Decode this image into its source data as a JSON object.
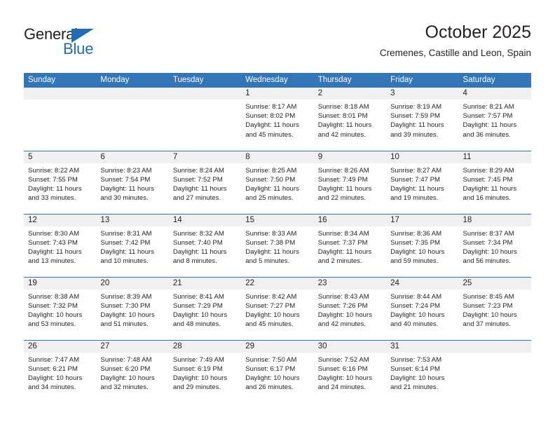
{
  "brand": {
    "name_top": "General",
    "name_bottom": "Blue",
    "accent_color": "#1f6db5",
    "triangle_icon": "brand-triangle-icon"
  },
  "header": {
    "title": "October 2025",
    "subtitle": "Cremenes, Castille and Leon, Spain"
  },
  "theme": {
    "header_row_bg": "#3276b8",
    "header_row_text": "#ffffff",
    "daynum_band_bg": "#f0f0f0",
    "row_divider": "#3276b8",
    "text": "#231f20",
    "cell_bg": "#ffffff"
  },
  "weekdays": [
    "Sunday",
    "Monday",
    "Tuesday",
    "Wednesday",
    "Thursday",
    "Friday",
    "Saturday"
  ],
  "labels": {
    "sunrise_prefix": "Sunrise:",
    "sunset_prefix": "Sunset:",
    "daylight_prefix": "Daylight:"
  },
  "weeks": [
    [
      {
        "day": "",
        "empty": true,
        "sunrise": "",
        "sunset": "",
        "daylight": ""
      },
      {
        "day": "",
        "empty": true,
        "sunrise": "",
        "sunset": "",
        "daylight": ""
      },
      {
        "day": "",
        "empty": true,
        "sunrise": "",
        "sunset": "",
        "daylight": ""
      },
      {
        "day": "1",
        "empty": false,
        "sunrise": "Sunrise: 8:17 AM",
        "sunset": "Sunset: 8:02 PM",
        "daylight": "Daylight: 11 hours and 45 minutes."
      },
      {
        "day": "2",
        "empty": false,
        "sunrise": "Sunrise: 8:18 AM",
        "sunset": "Sunset: 8:01 PM",
        "daylight": "Daylight: 11 hours and 42 minutes."
      },
      {
        "day": "3",
        "empty": false,
        "sunrise": "Sunrise: 8:19 AM",
        "sunset": "Sunset: 7:59 PM",
        "daylight": "Daylight: 11 hours and 39 minutes."
      },
      {
        "day": "4",
        "empty": false,
        "sunrise": "Sunrise: 8:21 AM",
        "sunset": "Sunset: 7:57 PM",
        "daylight": "Daylight: 11 hours and 36 minutes."
      }
    ],
    [
      {
        "day": "5",
        "empty": false,
        "sunrise": "Sunrise: 8:22 AM",
        "sunset": "Sunset: 7:55 PM",
        "daylight": "Daylight: 11 hours and 33 minutes."
      },
      {
        "day": "6",
        "empty": false,
        "sunrise": "Sunrise: 8:23 AM",
        "sunset": "Sunset: 7:54 PM",
        "daylight": "Daylight: 11 hours and 30 minutes."
      },
      {
        "day": "7",
        "empty": false,
        "sunrise": "Sunrise: 8:24 AM",
        "sunset": "Sunset: 7:52 PM",
        "daylight": "Daylight: 11 hours and 27 minutes."
      },
      {
        "day": "8",
        "empty": false,
        "sunrise": "Sunrise: 8:25 AM",
        "sunset": "Sunset: 7:50 PM",
        "daylight": "Daylight: 11 hours and 25 minutes."
      },
      {
        "day": "9",
        "empty": false,
        "sunrise": "Sunrise: 8:26 AM",
        "sunset": "Sunset: 7:49 PM",
        "daylight": "Daylight: 11 hours and 22 minutes."
      },
      {
        "day": "10",
        "empty": false,
        "sunrise": "Sunrise: 8:27 AM",
        "sunset": "Sunset: 7:47 PM",
        "daylight": "Daylight: 11 hours and 19 minutes."
      },
      {
        "day": "11",
        "empty": false,
        "sunrise": "Sunrise: 8:29 AM",
        "sunset": "Sunset: 7:45 PM",
        "daylight": "Daylight: 11 hours and 16 minutes."
      }
    ],
    [
      {
        "day": "12",
        "empty": false,
        "sunrise": "Sunrise: 8:30 AM",
        "sunset": "Sunset: 7:43 PM",
        "daylight": "Daylight: 11 hours and 13 minutes."
      },
      {
        "day": "13",
        "empty": false,
        "sunrise": "Sunrise: 8:31 AM",
        "sunset": "Sunset: 7:42 PM",
        "daylight": "Daylight: 11 hours and 10 minutes."
      },
      {
        "day": "14",
        "empty": false,
        "sunrise": "Sunrise: 8:32 AM",
        "sunset": "Sunset: 7:40 PM",
        "daylight": "Daylight: 11 hours and 8 minutes."
      },
      {
        "day": "15",
        "empty": false,
        "sunrise": "Sunrise: 8:33 AM",
        "sunset": "Sunset: 7:38 PM",
        "daylight": "Daylight: 11 hours and 5 minutes."
      },
      {
        "day": "16",
        "empty": false,
        "sunrise": "Sunrise: 8:34 AM",
        "sunset": "Sunset: 7:37 PM",
        "daylight": "Daylight: 11 hours and 2 minutes."
      },
      {
        "day": "17",
        "empty": false,
        "sunrise": "Sunrise: 8:36 AM",
        "sunset": "Sunset: 7:35 PM",
        "daylight": "Daylight: 10 hours and 59 minutes."
      },
      {
        "day": "18",
        "empty": false,
        "sunrise": "Sunrise: 8:37 AM",
        "sunset": "Sunset: 7:34 PM",
        "daylight": "Daylight: 10 hours and 56 minutes."
      }
    ],
    [
      {
        "day": "19",
        "empty": false,
        "sunrise": "Sunrise: 8:38 AM",
        "sunset": "Sunset: 7:32 PM",
        "daylight": "Daylight: 10 hours and 53 minutes."
      },
      {
        "day": "20",
        "empty": false,
        "sunrise": "Sunrise: 8:39 AM",
        "sunset": "Sunset: 7:30 PM",
        "daylight": "Daylight: 10 hours and 51 minutes."
      },
      {
        "day": "21",
        "empty": false,
        "sunrise": "Sunrise: 8:41 AM",
        "sunset": "Sunset: 7:29 PM",
        "daylight": "Daylight: 10 hours and 48 minutes."
      },
      {
        "day": "22",
        "empty": false,
        "sunrise": "Sunrise: 8:42 AM",
        "sunset": "Sunset: 7:27 PM",
        "daylight": "Daylight: 10 hours and 45 minutes."
      },
      {
        "day": "23",
        "empty": false,
        "sunrise": "Sunrise: 8:43 AM",
        "sunset": "Sunset: 7:26 PM",
        "daylight": "Daylight: 10 hours and 42 minutes."
      },
      {
        "day": "24",
        "empty": false,
        "sunrise": "Sunrise: 8:44 AM",
        "sunset": "Sunset: 7:24 PM",
        "daylight": "Daylight: 10 hours and 40 minutes."
      },
      {
        "day": "25",
        "empty": false,
        "sunrise": "Sunrise: 8:45 AM",
        "sunset": "Sunset: 7:23 PM",
        "daylight": "Daylight: 10 hours and 37 minutes."
      }
    ],
    [
      {
        "day": "26",
        "empty": false,
        "sunrise": "Sunrise: 7:47 AM",
        "sunset": "Sunset: 6:21 PM",
        "daylight": "Daylight: 10 hours and 34 minutes."
      },
      {
        "day": "27",
        "empty": false,
        "sunrise": "Sunrise: 7:48 AM",
        "sunset": "Sunset: 6:20 PM",
        "daylight": "Daylight: 10 hours and 32 minutes."
      },
      {
        "day": "28",
        "empty": false,
        "sunrise": "Sunrise: 7:49 AM",
        "sunset": "Sunset: 6:19 PM",
        "daylight": "Daylight: 10 hours and 29 minutes."
      },
      {
        "day": "29",
        "empty": false,
        "sunrise": "Sunrise: 7:50 AM",
        "sunset": "Sunset: 6:17 PM",
        "daylight": "Daylight: 10 hours and 26 minutes."
      },
      {
        "day": "30",
        "empty": false,
        "sunrise": "Sunrise: 7:52 AM",
        "sunset": "Sunset: 6:16 PM",
        "daylight": "Daylight: 10 hours and 24 minutes."
      },
      {
        "day": "31",
        "empty": false,
        "sunrise": "Sunrise: 7:53 AM",
        "sunset": "Sunset: 6:14 PM",
        "daylight": "Daylight: 10 hours and 21 minutes."
      },
      {
        "day": "",
        "empty": true,
        "sunrise": "",
        "sunset": "",
        "daylight": ""
      }
    ]
  ]
}
